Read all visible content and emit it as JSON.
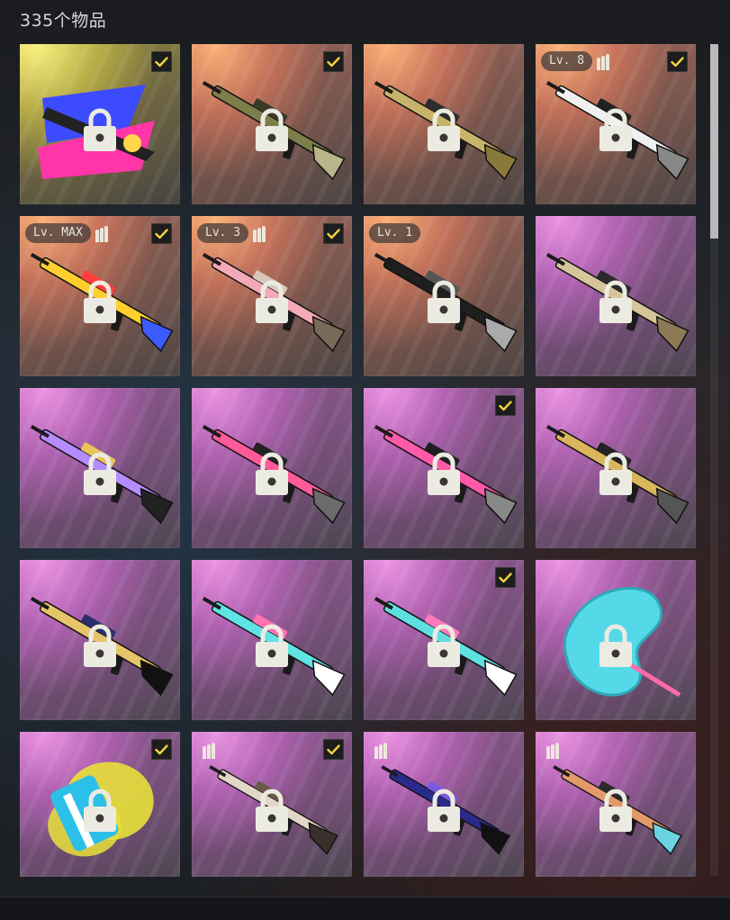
{
  "header": {
    "item_count_label": "335个物品"
  },
  "colors": {
    "check_accent": "#f2d43d",
    "lock_fill": "#ecebe2"
  },
  "grid": {
    "items": [
      {
        "name": "graffiti-assault-rifle-skin",
        "rarity": "gold",
        "checked": true,
        "level": "",
        "ammo": false,
        "locked": true,
        "icon": "rifle-graffiti-icon"
      },
      {
        "name": "ak-camo-skin",
        "rarity": "orange",
        "checked": true,
        "level": "",
        "ammo": false,
        "locked": true,
        "icon": "rifle-icon"
      },
      {
        "name": "gold-ornate-rifle-skin",
        "rarity": "orange",
        "checked": false,
        "level": "",
        "ammo": false,
        "locked": true,
        "icon": "rifle-icon"
      },
      {
        "name": "white-black-rifle-skin",
        "rarity": "orange",
        "checked": true,
        "level": "Lv. 8",
        "ammo": true,
        "locked": true,
        "icon": "rifle-icon"
      },
      {
        "name": "pop-art-rifle-skin",
        "rarity": "orange",
        "checked": true,
        "level": "Lv. MAX",
        "ammo": true,
        "locked": true,
        "icon": "rifle-icon"
      },
      {
        "name": "pink-sniper-skin",
        "rarity": "orange",
        "checked": true,
        "level": "Lv. 3",
        "ammo": true,
        "locked": true,
        "icon": "sniper-icon"
      },
      {
        "name": "black-drum-lmg-skin",
        "rarity": "orange",
        "checked": false,
        "level": "Lv. 1",
        "ammo": false,
        "locked": true,
        "icon": "lmg-icon"
      },
      {
        "name": "tan-sniper-skin",
        "rarity": "purple",
        "checked": false,
        "level": "",
        "ammo": false,
        "locked": true,
        "icon": "sniper-icon"
      },
      {
        "name": "purple-gold-rifle-skin",
        "rarity": "purple",
        "checked": false,
        "level": "",
        "ammo": false,
        "locked": true,
        "icon": "rifle-icon"
      },
      {
        "name": "pink-black-rifle-skin",
        "rarity": "purple",
        "checked": false,
        "level": "",
        "ammo": false,
        "locked": true,
        "icon": "rifle-icon"
      },
      {
        "name": "pink-marksman-skin",
        "rarity": "purple",
        "checked": true,
        "level": "",
        "ammo": false,
        "locked": true,
        "icon": "rifle-icon"
      },
      {
        "name": "gold-black-lmg-skin",
        "rarity": "purple",
        "checked": false,
        "level": "",
        "ammo": false,
        "locked": true,
        "icon": "lmg-icon"
      },
      {
        "name": "gold-blue-smg-skin",
        "rarity": "purple",
        "checked": false,
        "level": "",
        "ammo": false,
        "locked": true,
        "icon": "smg-icon"
      },
      {
        "name": "cyan-pink-rifle-skin",
        "rarity": "purple",
        "checked": false,
        "level": "",
        "ammo": false,
        "locked": true,
        "icon": "rifle-icon"
      },
      {
        "name": "cyan-pink-lmg-skin",
        "rarity": "purple",
        "checked": true,
        "level": "",
        "ammo": false,
        "locked": true,
        "icon": "lmg-icon"
      },
      {
        "name": "cyan-parachute-trail-item",
        "rarity": "purple",
        "checked": false,
        "level": "",
        "ammo": false,
        "locked": true,
        "icon": "palette-icon"
      },
      {
        "name": "yellow-smoke-parachute-item",
        "rarity": "purple",
        "checked": true,
        "level": "",
        "ammo": false,
        "locked": true,
        "icon": "parachute-icon"
      },
      {
        "name": "engraved-shotgun-skin",
        "rarity": "purple",
        "checked": true,
        "level": "",
        "ammo": true,
        "locked": true,
        "icon": "shotgun-icon"
      },
      {
        "name": "blue-purple-rifle-skin",
        "rarity": "purple",
        "checked": false,
        "level": "",
        "ammo": true,
        "locked": true,
        "icon": "rifle-icon"
      },
      {
        "name": "copper-rifle-skin",
        "rarity": "purple",
        "checked": false,
        "level": "",
        "ammo": true,
        "locked": true,
        "icon": "rifle-icon"
      }
    ]
  }
}
